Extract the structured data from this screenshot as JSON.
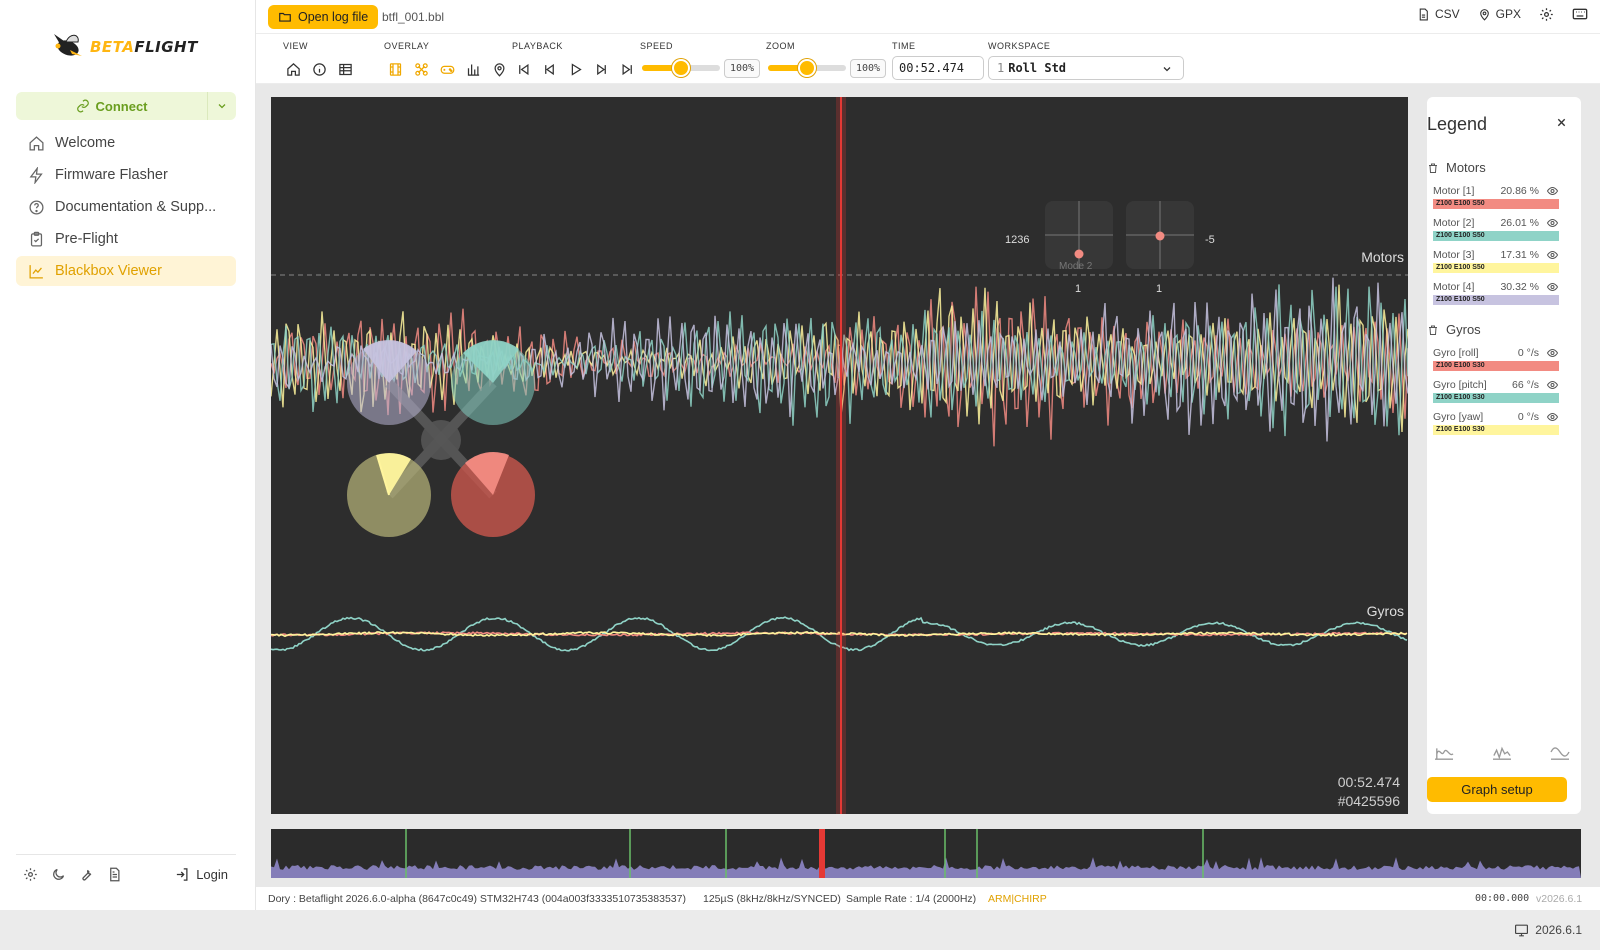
{
  "app": {
    "logo_beta": "BETA",
    "logo_flight": "FLIGHT",
    "connect_label": "Connect"
  },
  "sidebar": {
    "items": [
      {
        "label": "Welcome",
        "icon": "home-icon"
      },
      {
        "label": "Firmware Flasher",
        "icon": "bolt-icon"
      },
      {
        "label": "Documentation & Supp...",
        "icon": "help-icon"
      },
      {
        "label": "Pre-Flight",
        "icon": "clipboard-check-icon"
      },
      {
        "label": "Blackbox Viewer",
        "icon": "chart-line-icon",
        "active": true
      }
    ],
    "login_label": "Login"
  },
  "topbar": {
    "open_label": "Open log file",
    "file_name": "btfl_001.bbl",
    "csv_label": "CSV",
    "gpx_label": "GPX"
  },
  "toolbar": {
    "view_label": "VIEW",
    "overlay_label": "OVERLAY",
    "playback_label": "PLAYBACK",
    "speed_label": "SPEED",
    "zoom_label": "ZOOM",
    "time_label": "TIME",
    "workspace_label": "WORKSPACE",
    "speed_value": "100%",
    "speed_fraction": 0.5,
    "zoom_value": "100%",
    "zoom_fraction": 0.5,
    "time_value": "00:52.474",
    "workspace_num": "1",
    "workspace_name": "Roll Std"
  },
  "graph": {
    "motors_label": "Motors",
    "gyros_label": "Gyros",
    "time_overlay": "00:52.474",
    "frame_overlay": "#0425596",
    "stick_left_value": "1236",
    "stick_right_value": "-5",
    "stick_left_bottom": "1",
    "stick_right_bottom": "1",
    "mode_label": "Mode 2",
    "colors": {
      "motor1": "#f28b82",
      "motor2": "#8fd3c7",
      "motor3": "#fff59d",
      "motor4": "#c7c3e0",
      "cursor": "#e53935"
    }
  },
  "legend": {
    "title": "Legend",
    "groups": [
      {
        "name": "Motors",
        "rows": [
          {
            "name": "Motor [1]",
            "value": "20.86 %",
            "tag": "Z100 E100 S50",
            "color": "#f28b82"
          },
          {
            "name": "Motor [2]",
            "value": "26.01 %",
            "tag": "Z100 E100 S50",
            "color": "#8fd3c7"
          },
          {
            "name": "Motor [3]",
            "value": "17.31 %",
            "tag": "Z100 E100 S50",
            "color": "#fff59d"
          },
          {
            "name": "Motor [4]",
            "value": "30.32 %",
            "tag": "Z100 E100 S50",
            "color": "#c7c3e0"
          }
        ]
      },
      {
        "name": "Gyros",
        "rows": [
          {
            "name": "Gyro [roll]",
            "value": "0 °/s",
            "tag": "Z100 E100 S30",
            "color": "#f28b82"
          },
          {
            "name": "Gyro [pitch]",
            "value": "66 °/s",
            "tag": "Z100 E100 S30",
            "color": "#8fd3c7"
          },
          {
            "name": "Gyro [yaw]",
            "value": "0 °/s",
            "tag": "Z100 E100 S30",
            "color": "#fff59d"
          }
        ]
      }
    ],
    "setup_label": "Graph setup"
  },
  "status": {
    "craft": "Dory : Betaflight 2026.6.0-alpha (8647c0c49) STM32H743 (004a003f3333510735383537)",
    "loop": "125µS (8kHz/8kHz/SYNCED)",
    "sample": "Sample Rate : 1/4 (2000Hz)",
    "flags": "ARM|CHIRP",
    "time": "00:00.000",
    "version_small": "v2026.6.1"
  },
  "footer": {
    "version": "2026.6.1"
  }
}
